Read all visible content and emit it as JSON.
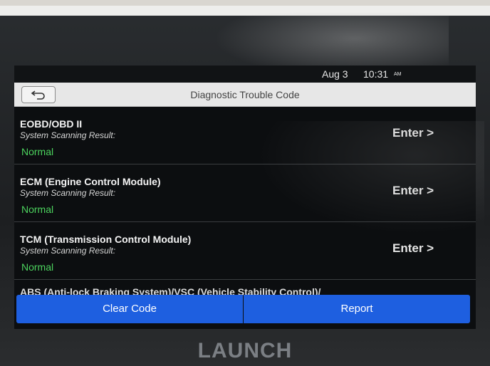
{
  "status_bar": {
    "date": "Aug 3",
    "time": "10:31",
    "ampm": "AM"
  },
  "header": {
    "title": "Diagnostic Trouble Code"
  },
  "systems": [
    {
      "name": "EOBD/OBD II",
      "scan_label": "System Scanning Result:",
      "status": "Normal",
      "action": "Enter >"
    },
    {
      "name": "ECM (Engine Control Module)",
      "scan_label": "System Scanning Result:",
      "status": "Normal",
      "action": "Enter >"
    },
    {
      "name": "TCM (Transmission Control Module)",
      "scan_label": "System Scanning Result:",
      "status": "Normal",
      "action": "Enter >"
    }
  ],
  "partial_item": "ABS (Anti-lock Braking System)/VSC (Vehicle Stability Control)/",
  "buttons": {
    "clear_code": "Clear Code",
    "report": "Report"
  },
  "device": {
    "brand": "LAUNCH"
  },
  "colors": {
    "accent": "#1e5fe0",
    "status_ok": "#4cd35e"
  }
}
